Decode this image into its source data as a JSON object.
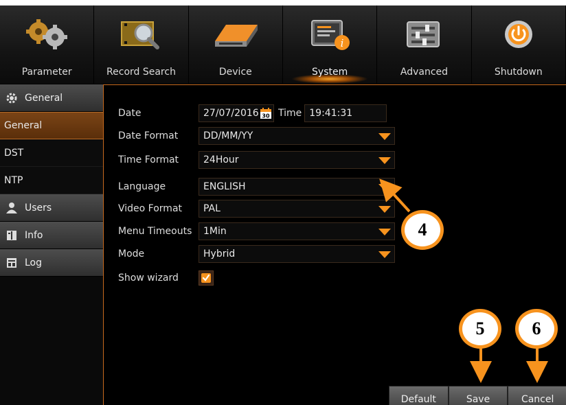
{
  "nav": {
    "tabs": [
      {
        "label": "Parameter",
        "icon": "gears-icon"
      },
      {
        "label": "Record Search",
        "icon": "film-magnifier-icon"
      },
      {
        "label": "Device",
        "icon": "hard-drive-icon"
      },
      {
        "label": "System",
        "icon": "system-info-icon"
      },
      {
        "label": "Advanced",
        "icon": "sliders-icon"
      },
      {
        "label": "Shutdown",
        "icon": "power-icon"
      }
    ],
    "active": "System"
  },
  "sidebar": {
    "header": {
      "label": "General",
      "icon": "gear-icon"
    },
    "items": [
      "General",
      "DST",
      "NTP"
    ],
    "sections": [
      {
        "label": "Users",
        "icon": "user-icon"
      },
      {
        "label": "Info",
        "icon": "info-icon"
      },
      {
        "label": "Log",
        "icon": "log-icon"
      }
    ]
  },
  "form": {
    "date_label": "Date",
    "date_value": "27/07/2016",
    "calendar_day": "30",
    "time_label": "Time",
    "time_value": "19:41:31",
    "date_format_label": "Date Format",
    "date_format_value": "DD/MM/YY",
    "time_format_label": "Time Format",
    "time_format_value": "24Hour",
    "language_label": "Language",
    "language_value": "ENGLISH",
    "video_format_label": "Video Format",
    "video_format_value": "PAL",
    "menu_timeouts_label": "Menu Timeouts",
    "menu_timeouts_value": "1Min",
    "mode_label": "Mode",
    "mode_value": "Hybrid",
    "show_wizard_label": "Show wizard",
    "show_wizard_checked": true
  },
  "buttons": {
    "default": "Default",
    "save": "Save",
    "cancel": "Cancel"
  },
  "callouts": {
    "c4": "4",
    "c5": "5",
    "c6": "6"
  },
  "colors": {
    "accent": "#f7931e",
    "active_item": "#6a3912"
  }
}
